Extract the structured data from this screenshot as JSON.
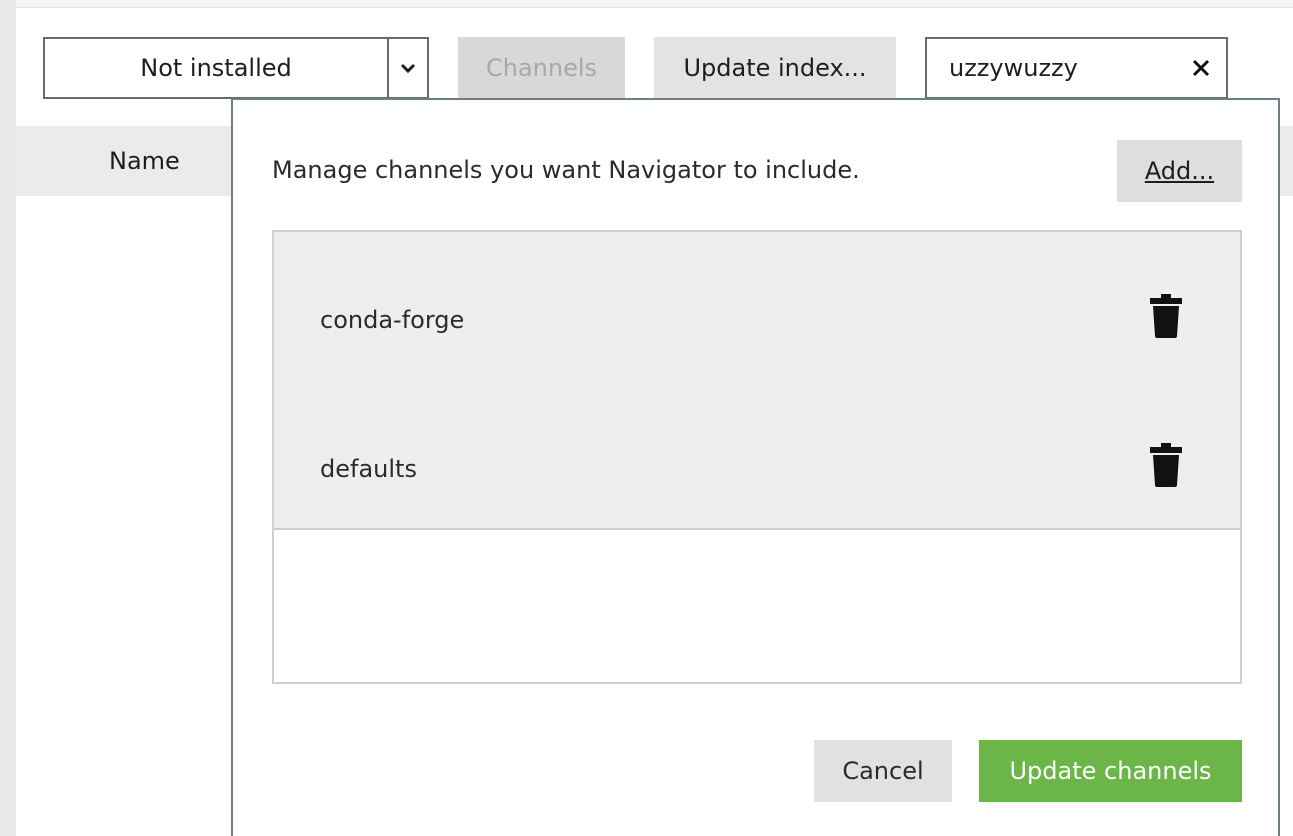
{
  "toolbar": {
    "filter_value": "Not installed",
    "channels_label": "Channels",
    "update_index_label": "Update index...",
    "search_value": "uzzywuzzy"
  },
  "table": {
    "columns": [
      "Name"
    ]
  },
  "dialog": {
    "prompt": "Manage channels you want Navigator to include.",
    "add_label": "Add...",
    "channels": [
      {
        "name": "conda-forge",
        "icon": "trash-icon"
      },
      {
        "name": "defaults",
        "icon": "trash-icon"
      }
    ],
    "cancel_label": "Cancel",
    "update_label": "Update channels"
  },
  "colors": {
    "primary_green": "#6bb549",
    "border_gray": "#6a6a6a",
    "dialog_border": "#6f7f87",
    "row_bg": "#eeeeee"
  }
}
